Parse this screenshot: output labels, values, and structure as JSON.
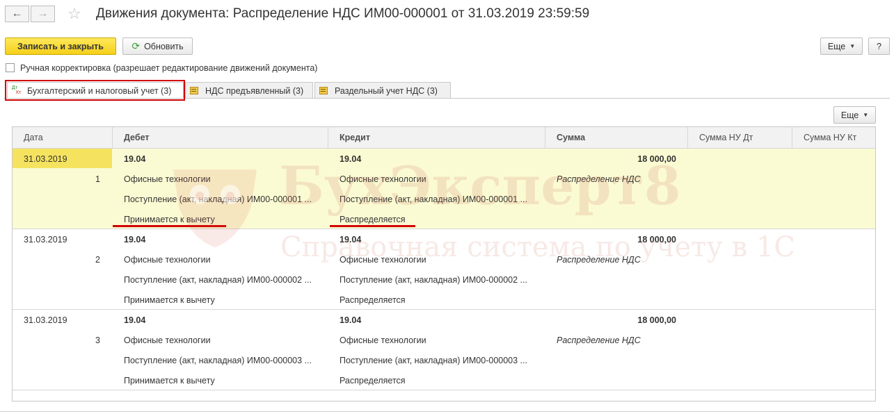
{
  "header": {
    "title": "Движения документа: Распределение НДС ИМ00-000001 от 31.03.2019 23:59:59"
  },
  "toolbar": {
    "save_close_label": "Записать и закрыть",
    "refresh_label": "Обновить",
    "more_label": "Еще",
    "help_label": "?"
  },
  "manual_edit": {
    "label": "Ручная корректировка (разрешает редактирование движений документа)",
    "checked": false
  },
  "tabs": [
    {
      "label": "Бухгалтерский и налоговый учет (3)",
      "icon": "dt-kt-icon",
      "active": true
    },
    {
      "label": "НДС предъявленный (3)",
      "icon": "register-icon",
      "active": false
    },
    {
      "label": "Раздельный учет НДС (3)",
      "icon": "register-icon",
      "active": false
    }
  ],
  "table_toolbar": {
    "more_label": "Еще"
  },
  "table": {
    "columns": [
      "Дата",
      "Дебет",
      "Кредит",
      "Сумма",
      "Сумма НУ Дт",
      "Сумма НУ Кт"
    ],
    "rows": [
      {
        "date": "31.03.2019",
        "num": "1",
        "debit_account": "19.04",
        "debit_sub1": "Офисные технологии",
        "debit_sub2": "Поступление (акт, накладная) ИМ00-000001 ...",
        "debit_sub3": "Принимается к вычету",
        "credit_account": "19.04",
        "credit_sub1": "Офисные технологии",
        "credit_sub2": "Поступление (акт, накладная) ИМ00-000001 ...",
        "credit_sub3": "Распределяется",
        "amount": "18 000,00",
        "content": "Распределение НДС"
      },
      {
        "date": "31.03.2019",
        "num": "2",
        "debit_account": "19.04",
        "debit_sub1": "Офисные технологии",
        "debit_sub2": "Поступление (акт, накладная) ИМ00-000002 ...",
        "debit_sub3": "Принимается к вычету",
        "credit_account": "19.04",
        "credit_sub1": "Офисные технологии",
        "credit_sub2": "Поступление (акт, накладная) ИМ00-000002 ...",
        "credit_sub3": "Распределяется",
        "amount": "18 000,00",
        "content": "Распределение НДС"
      },
      {
        "date": "31.03.2019",
        "num": "3",
        "debit_account": "19.04",
        "debit_sub1": "Офисные технологии",
        "debit_sub2": "Поступление (акт, накладная) ИМ00-000003 ...",
        "debit_sub3": "Принимается к вычету",
        "credit_account": "19.04",
        "credit_sub1": "Офисные технологии",
        "credit_sub2": "Поступление (акт, накладная) ИМ00-000003 ...",
        "credit_sub3": "Распределяется",
        "amount": "18 000,00",
        "content": "Распределение НДС"
      }
    ]
  },
  "watermark": {
    "brand": "БухЭксперт8",
    "tagline": "Справочная система по учету в 1С"
  },
  "colors": {
    "primary_button": "#f5d31f",
    "selected_row": "#fbfbd3",
    "highlight_red": "#d00000"
  }
}
